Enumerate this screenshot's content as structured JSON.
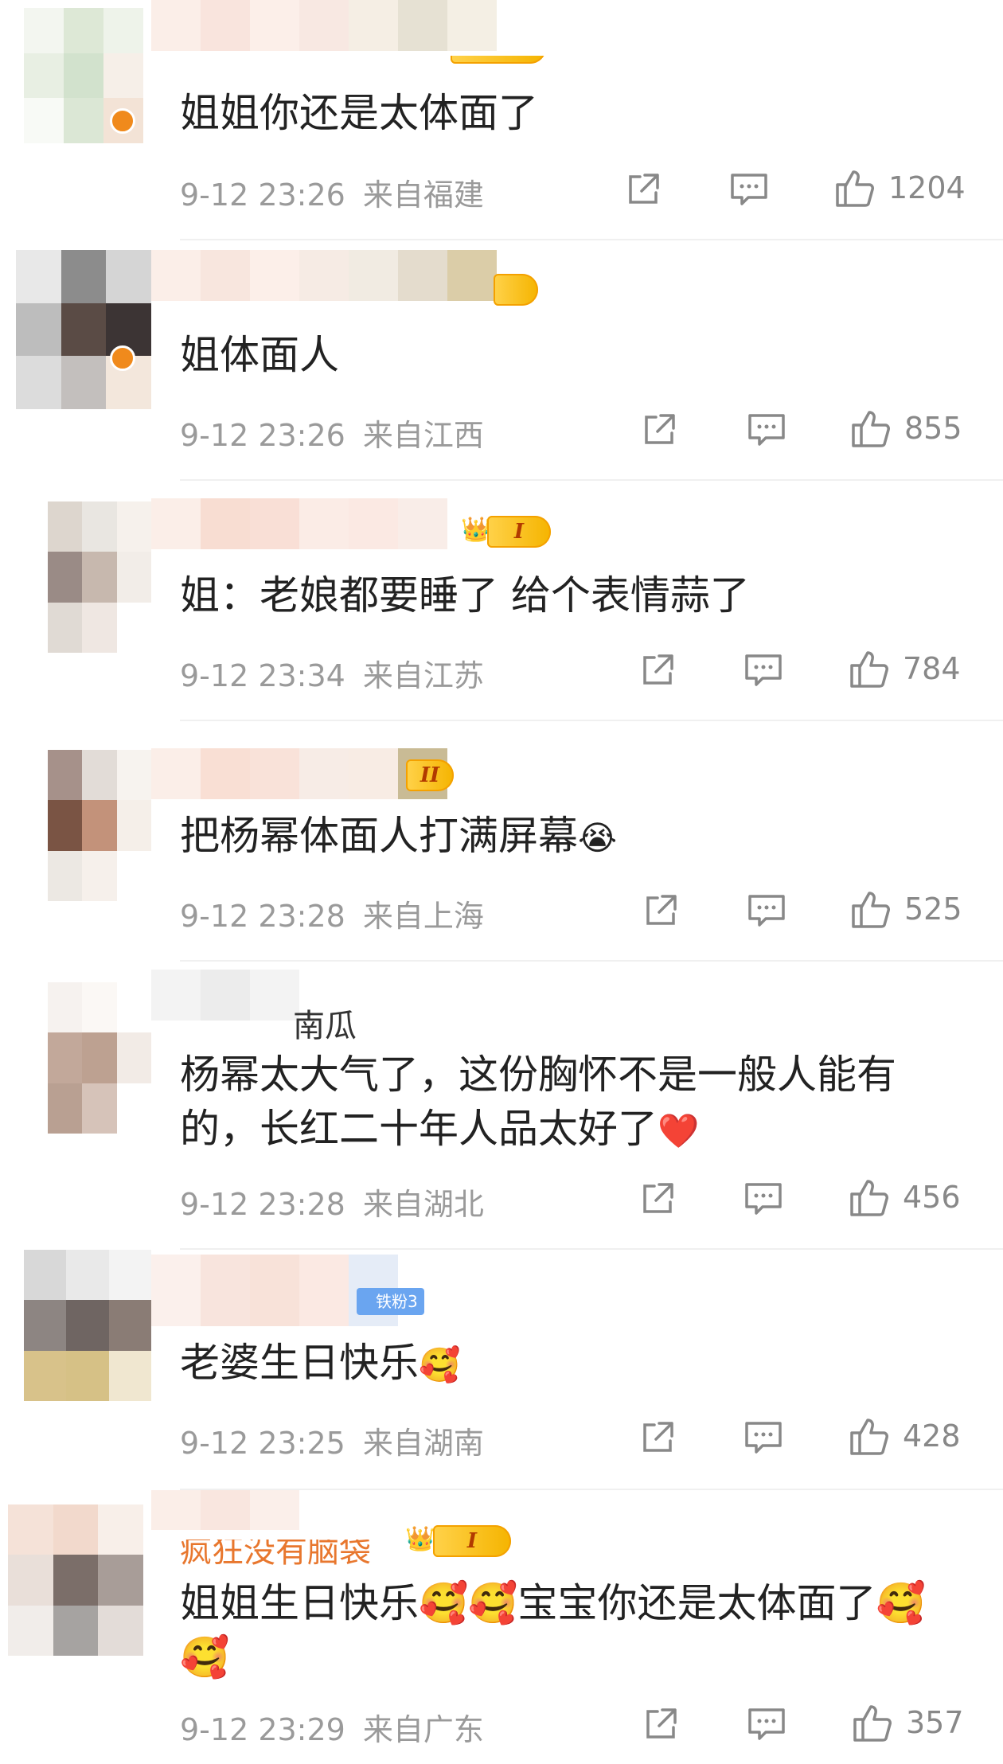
{
  "comments": [
    {
      "username": "",
      "name_suffix": "",
      "level": "",
      "text": "姐姐你还是太体面了",
      "emojis": "",
      "time": "9-12 23:26",
      "location": "来自福建",
      "likes": "1204"
    },
    {
      "username": "",
      "name_suffix": "",
      "level": "",
      "text": "姐体面人",
      "emojis": "",
      "time": "9-12 23:26",
      "location": "来自江西",
      "likes": "855"
    },
    {
      "username": "",
      "name_suffix": "",
      "level": "I",
      "text": "姐：老娘都要睡了 给个表情蒜了",
      "emojis": "",
      "time": "9-12 23:34",
      "location": "来自江苏",
      "likes": "784"
    },
    {
      "username": "",
      "name_suffix": "",
      "level": "II",
      "text": "把杨幂体面人打满屏幕",
      "emojis": "😭",
      "time": "9-12 23:28",
      "location": "来自上海",
      "likes": "525"
    },
    {
      "username": "",
      "name_suffix": "南瓜",
      "level": "",
      "text": "杨幂太大气了，这份胸怀不是一般人能有的，长红二十年人品太好了",
      "emojis": "❤️",
      "time": "9-12 23:28",
      "location": "来自湖北",
      "likes": "456"
    },
    {
      "username": "",
      "name_suffix": "",
      "fan_badge": "铁粉3",
      "text": "老婆生日快乐",
      "emojis": "🥰",
      "time": "9-12 23:25",
      "location": "来自湖南",
      "likes": "428"
    },
    {
      "username": "",
      "name_suffix": "疯狂没有脑袋",
      "level": "I",
      "text": "姐姐生日快乐🥰🥰宝宝你还是太体面了🥰🥰",
      "emojis": "",
      "time": "9-12 23:29",
      "location": "来自广东",
      "likes": "357"
    }
  ],
  "icons": {
    "share": "share-icon",
    "comment": "comment-icon",
    "like": "thumbs-up-icon"
  },
  "colors": {
    "meta_gray": "#9a9a9a",
    "level_gold": "#f5b400",
    "fan_blue": "#6aa5f0",
    "name_orange": "#e8772e"
  }
}
